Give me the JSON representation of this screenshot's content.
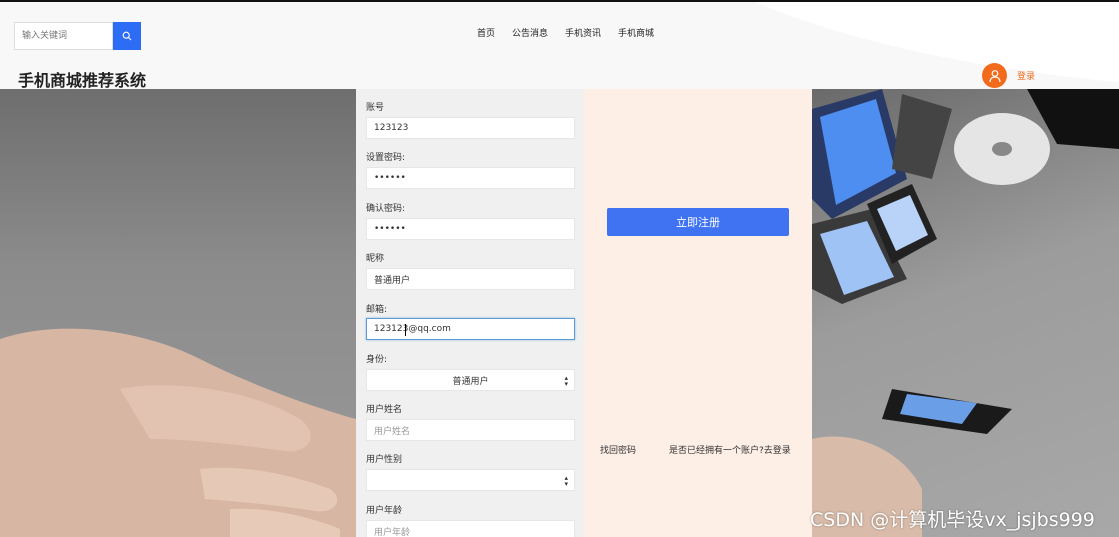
{
  "search": {
    "placeholder": "输入关键词"
  },
  "nav": [
    "首页",
    "公告消息",
    "手机资讯",
    "手机商城"
  ],
  "site_title": "手机商城推荐系统",
  "login_label": "登录",
  "form": {
    "account_label": "账号",
    "account_value": "123123",
    "password_label": "设置密码:",
    "password_value": "••••••",
    "confirm_label": "确认密码:",
    "confirm_value": "••••••",
    "nickname_label": "昵称",
    "nickname_value": "普通用户",
    "email_label": "邮箱:",
    "email_value": "123123@qq.com",
    "role_label": "身份:",
    "role_value": "普通用户",
    "name_label": "用户姓名",
    "name_placeholder": "用户姓名",
    "gender_label": "用户性别",
    "age_label": "用户年龄",
    "age_placeholder": "用户年龄"
  },
  "register_button": "立即注册",
  "forgot_link": "找回密码",
  "login_prompt": "是否已经拥有一个账户?去登录",
  "watermark": "CSDN @计算机毕设vx_jsjbs999",
  "colors": {
    "accent": "#3f73f2",
    "login": "#f26b1d",
    "panel": "#fdeee6"
  }
}
